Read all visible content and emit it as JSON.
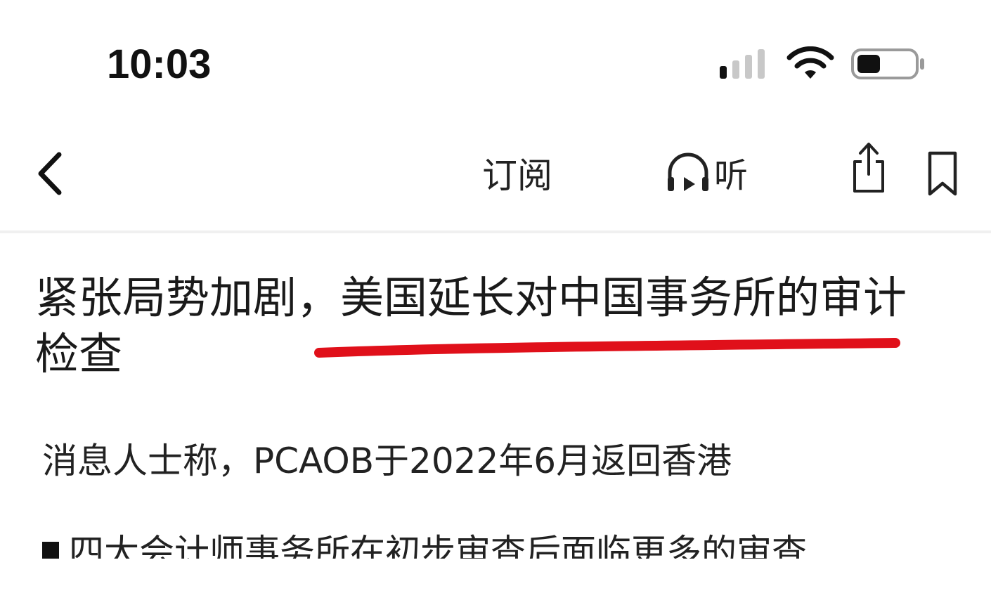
{
  "status_bar": {
    "time": "10:03",
    "icons": [
      "cellular-signal-icon",
      "wifi-icon",
      "battery-icon"
    ]
  },
  "nav": {
    "subscribe_label": "订阅",
    "listen_label": "听",
    "icons": [
      "back-chevron-icon",
      "headphones-icon",
      "share-icon",
      "bookmark-icon"
    ]
  },
  "article": {
    "headline": "紧张局势加剧，美国延长对中国事务所的审计检查",
    "subtitle": "消息人士称，PCAOB于2022年6月返回香港",
    "bullets": [
      "四大会计师事务所在初步审查后面临更多的审查"
    ]
  },
  "colors": {
    "underline": "#e0101a",
    "text": "#1a1a1a",
    "divider": "#f0f0f0"
  }
}
